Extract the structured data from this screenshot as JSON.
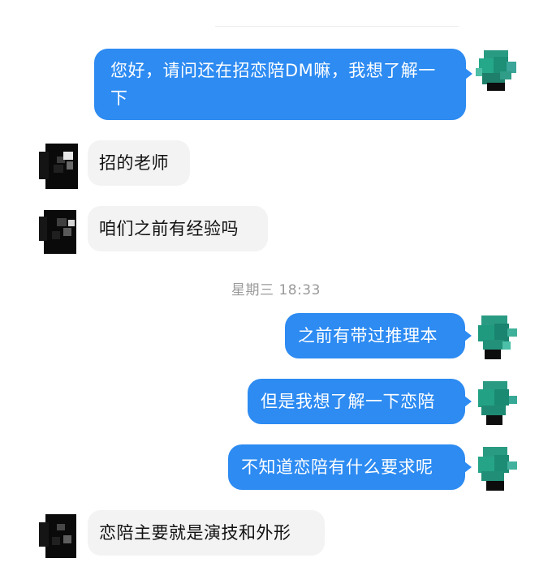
{
  "conversation": {
    "timestamp": "星期三 18:33",
    "messages": [
      {
        "from": "me",
        "text": "您好，请问还在招恋陪DM嘛，我想了解一下"
      },
      {
        "from": "other",
        "text": "招的老师"
      },
      {
        "from": "other",
        "text": "咱们之前有经验吗"
      },
      {
        "from": "me",
        "text": "之前有带过推理本"
      },
      {
        "from": "me",
        "text": "但是我想了解一下恋陪"
      },
      {
        "from": "me",
        "text": "不知道恋陪有什么要求呢"
      },
      {
        "from": "other",
        "text": "恋陪主要就是演技和外形"
      }
    ]
  },
  "colors": {
    "outgoing_bubble": "#2d8bf2",
    "incoming_bubble": "#f3f3f3",
    "timestamp_text": "#9a9a9a",
    "my_avatar": "#1fa07e",
    "other_avatar": "#0a0a0a"
  },
  "icons": {
    "my_avatar": "pixelated-avatar-icon",
    "other_avatar": "pixelated-avatar-icon"
  }
}
